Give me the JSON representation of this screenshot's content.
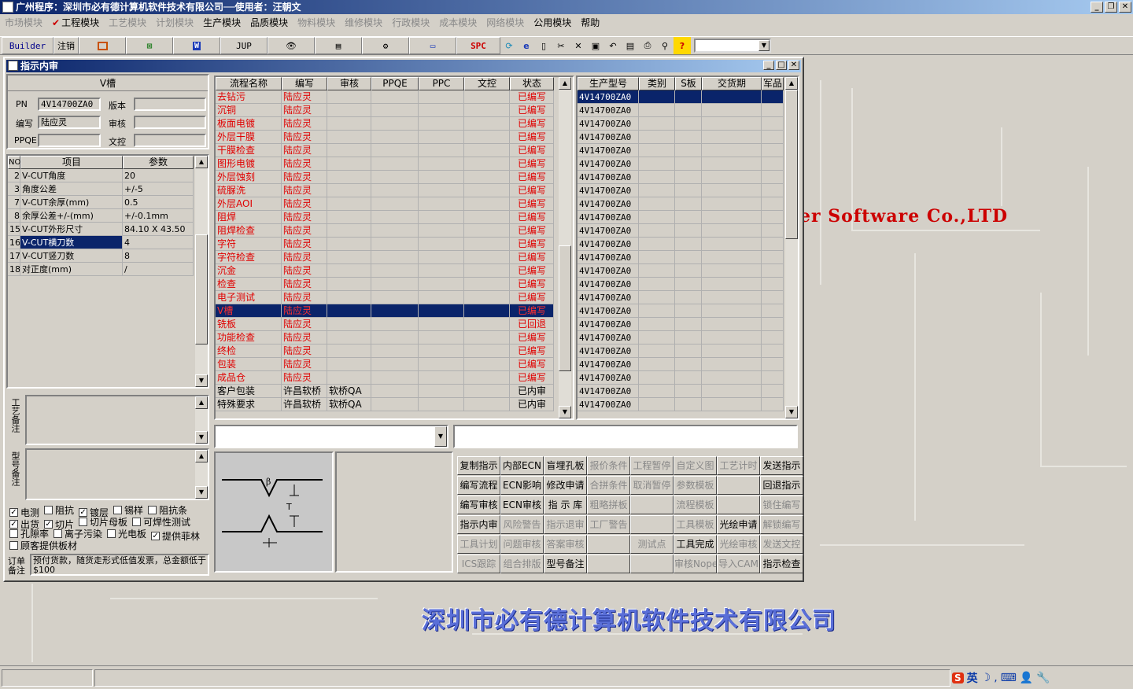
{
  "app_title": "广州程序：深圳市必有德计算机软件技术有限公司──使用者：汪朝文",
  "menus": [
    {
      "label": "市场模块",
      "on": false
    },
    {
      "label": "工程模块",
      "on": true,
      "checked": true
    },
    {
      "label": "工艺模块",
      "on": false
    },
    {
      "label": "计划模块",
      "on": false
    },
    {
      "label": "生产模块",
      "on": true
    },
    {
      "label": "品质模块",
      "on": true
    },
    {
      "label": "物料模块",
      "on": false
    },
    {
      "label": "维修模块",
      "on": false
    },
    {
      "label": "行政模块",
      "on": false
    },
    {
      "label": "成本模块",
      "on": false
    },
    {
      "label": "网络模块",
      "on": false
    },
    {
      "label": "公用模块",
      "on": true
    },
    {
      "label": "帮助",
      "on": true
    }
  ],
  "toolbar": {
    "builder": "Builder",
    "logout": "注销",
    "jup": "JUP",
    "spc": "SPC"
  },
  "bg_text": "er Software Co.,LTD",
  "company": "深圳市必有德计算机软件技术有限公司",
  "window": {
    "title": "指示内审"
  },
  "header": {
    "process": "V槽",
    "pn_label": "PN",
    "pn": "4V14700ZA0",
    "version_label": "版本",
    "version": "",
    "writer_label": "编写",
    "writer": "陆应灵",
    "review_label": "审核",
    "review": "",
    "ppqe_label": "PPQE",
    "ppqe": "",
    "doc_label": "文控",
    "doc": ""
  },
  "param_table": {
    "cols": [
      "NO",
      "项目",
      "参数"
    ],
    "rows": [
      [
        "2",
        "V-CUT角度",
        "20"
      ],
      [
        "3",
        "角度公差",
        "+/-5"
      ],
      [
        "7",
        "V-CUT余厚(mm)",
        "0.5"
      ],
      [
        "8",
        "余厚公差+/-(mm)",
        "+/-0.1mm"
      ],
      [
        "15",
        "V-CUT外形尺寸",
        "84.10 X 43.50"
      ],
      [
        "16",
        "V-CUT横刀数",
        "4"
      ],
      [
        "17",
        "V-CUT竖刀数",
        "8"
      ],
      [
        "18",
        "对正度(mm)",
        "/"
      ]
    ]
  },
  "memo_labels": {
    "craft": "工艺备注",
    "model": "型号备注",
    "order": "订单备注"
  },
  "checkboxes": [
    [
      {
        "label": "电测",
        "checked": true
      },
      {
        "label": "阻抗",
        "checked": false
      },
      {
        "label": "镀层",
        "checked": true
      },
      {
        "label": "锡样",
        "checked": false
      },
      {
        "label": "阻抗条",
        "checked": false
      }
    ],
    [
      {
        "label": "出货",
        "checked": true
      },
      {
        "label": "切片",
        "checked": true
      },
      {
        "label": "切片母板",
        "checked": false
      },
      {
        "label": "可焊性测试",
        "checked": false
      }
    ],
    [
      {
        "label": "孔隙率",
        "checked": false
      },
      {
        "label": "离子污染",
        "checked": false
      },
      {
        "label": "光电板",
        "checked": false
      },
      {
        "label": "提供菲林",
        "checked": true
      }
    ],
    [
      {
        "label": "顾客提供板材",
        "checked": false
      }
    ]
  ],
  "order_note": "预付货款，随货走形式低值发票，总金额低于$100",
  "flow_table": {
    "cols": [
      "流程名称",
      "编写",
      "审核",
      "PPQE",
      "PPC",
      "文控",
      "状态"
    ],
    "rows": [
      {
        "name": "去钻污",
        "writer": "陆应灵",
        "review": "",
        "ppqe": "",
        "ppc": "",
        "doc": "",
        "status": "已编写",
        "red": true
      },
      {
        "name": "沉铜",
        "writer": "陆应灵",
        "review": "",
        "ppqe": "",
        "ppc": "",
        "doc": "",
        "status": "已编写",
        "red": true
      },
      {
        "name": "板面电镀",
        "writer": "陆应灵",
        "review": "",
        "ppqe": "",
        "ppc": "",
        "doc": "",
        "status": "已编写",
        "red": true
      },
      {
        "name": "外层干膜",
        "writer": "陆应灵",
        "review": "",
        "ppqe": "",
        "ppc": "",
        "doc": "",
        "status": "已编写",
        "red": true
      },
      {
        "name": "干膜检查",
        "writer": "陆应灵",
        "review": "",
        "ppqe": "",
        "ppc": "",
        "doc": "",
        "status": "已编写",
        "red": true
      },
      {
        "name": "图形电镀",
        "writer": "陆应灵",
        "review": "",
        "ppqe": "",
        "ppc": "",
        "doc": "",
        "status": "已编写",
        "red": true
      },
      {
        "name": "外层蚀刻",
        "writer": "陆应灵",
        "review": "",
        "ppqe": "",
        "ppc": "",
        "doc": "",
        "status": "已编写",
        "red": true
      },
      {
        "name": "硫脲洗",
        "writer": "陆应灵",
        "review": "",
        "ppqe": "",
        "ppc": "",
        "doc": "",
        "status": "已编写",
        "red": true
      },
      {
        "name": "外层AOI",
        "writer": "陆应灵",
        "review": "",
        "ppqe": "",
        "ppc": "",
        "doc": "",
        "status": "已编写",
        "red": true
      },
      {
        "name": "阻焊",
        "writer": "陆应灵",
        "review": "",
        "ppqe": "",
        "ppc": "",
        "doc": "",
        "status": "已编写",
        "red": true
      },
      {
        "name": "阻焊检查",
        "writer": "陆应灵",
        "review": "",
        "ppqe": "",
        "ppc": "",
        "doc": "",
        "status": "已编写",
        "red": true
      },
      {
        "name": "字符",
        "writer": "陆应灵",
        "review": "",
        "ppqe": "",
        "ppc": "",
        "doc": "",
        "status": "已编写",
        "red": true
      },
      {
        "name": "字符检查",
        "writer": "陆应灵",
        "review": "",
        "ppqe": "",
        "ppc": "",
        "doc": "",
        "status": "已编写",
        "red": true
      },
      {
        "name": "沉金",
        "writer": "陆应灵",
        "review": "",
        "ppqe": "",
        "ppc": "",
        "doc": "",
        "status": "已编写",
        "red": true
      },
      {
        "name": "检查",
        "writer": "陆应灵",
        "review": "",
        "ppqe": "",
        "ppc": "",
        "doc": "",
        "status": "已编写",
        "red": true
      },
      {
        "name": "电子测试",
        "writer": "陆应灵",
        "review": "",
        "ppqe": "",
        "ppc": "",
        "doc": "",
        "status": "已编写",
        "red": true
      },
      {
        "name": "V槽",
        "writer": "陆应灵",
        "review": "",
        "ppqe": "",
        "ppc": "",
        "doc": "",
        "status": "已编写",
        "red": true,
        "selected": true
      },
      {
        "name": "铣板",
        "writer": "陆应灵",
        "review": "",
        "ppqe": "",
        "ppc": "",
        "doc": "",
        "status": "已回退",
        "red": true
      },
      {
        "name": "功能检查",
        "writer": "陆应灵",
        "review": "",
        "ppqe": "",
        "ppc": "",
        "doc": "",
        "status": "已编写",
        "red": true
      },
      {
        "name": "终检",
        "writer": "陆应灵",
        "review": "",
        "ppqe": "",
        "ppc": "",
        "doc": "",
        "status": "已编写",
        "red": true
      },
      {
        "name": "包装",
        "writer": "陆应灵",
        "review": "",
        "ppqe": "",
        "ppc": "",
        "doc": "",
        "status": "已编写",
        "red": true
      },
      {
        "name": "成品仓",
        "writer": "陆应灵",
        "review": "",
        "ppqe": "",
        "ppc": "",
        "doc": "",
        "status": "已编写",
        "red": true
      },
      {
        "name": "客户包装",
        "writer": "许昌软桥",
        "review": "软桥QA",
        "ppqe": "",
        "ppc": "",
        "doc": "",
        "status": "已内审",
        "red": false
      },
      {
        "name": "特殊要求",
        "writer": "许昌软桥",
        "review": "软桥QA",
        "ppqe": "",
        "ppc": "",
        "doc": "",
        "status": "已内审",
        "red": false
      }
    ]
  },
  "model_table": {
    "cols": [
      "生产型号",
      "类别",
      "S板",
      "交货期",
      "军品"
    ],
    "model": "4V14700ZA0",
    "count": 24
  },
  "diagram": {
    "beta": "β",
    "t": "T"
  },
  "action_buttons": [
    [
      {
        "l": "复制指示",
        "d": false
      },
      {
        "l": "内部ECN",
        "d": false
      },
      {
        "l": "盲埋孔板",
        "d": false
      },
      {
        "l": "报价条件",
        "d": true
      },
      {
        "l": "工程暂停",
        "d": true
      },
      {
        "l": "自定义图",
        "d": true
      },
      {
        "l": "工艺计时",
        "d": true
      },
      {
        "l": "发送指示",
        "d": false
      }
    ],
    [
      {
        "l": "编写流程",
        "d": false
      },
      {
        "l": "ECN影响",
        "d": false
      },
      {
        "l": "修改申请",
        "d": false
      },
      {
        "l": "合拼条件",
        "d": true
      },
      {
        "l": "取消暂停",
        "d": true
      },
      {
        "l": "参数模板",
        "d": true
      },
      {
        "l": "",
        "d": true
      },
      {
        "l": "回退指示",
        "d": false
      }
    ],
    [
      {
        "l": "编写审核",
        "d": false
      },
      {
        "l": "ECN审核",
        "d": false
      },
      {
        "l": "指 示 库",
        "d": false
      },
      {
        "l": "粗略拼板",
        "d": true
      },
      {
        "l": "",
        "d": true
      },
      {
        "l": "流程模板",
        "d": true
      },
      {
        "l": "",
        "d": true
      },
      {
        "l": "锁住编写",
        "d": true
      }
    ],
    [
      {
        "l": "指示内审",
        "d": false
      },
      {
        "l": "风险警告",
        "d": true
      },
      {
        "l": "指示退审",
        "d": true
      },
      {
        "l": "工厂警告",
        "d": true
      },
      {
        "l": "",
        "d": true
      },
      {
        "l": "工具模板",
        "d": true
      },
      {
        "l": "光绘申请",
        "d": false
      },
      {
        "l": "解锁编写",
        "d": true
      }
    ],
    [
      {
        "l": "工具计划",
        "d": true
      },
      {
        "l": "问题审核",
        "d": true
      },
      {
        "l": "答案审核",
        "d": true
      },
      {
        "l": "",
        "d": true
      },
      {
        "l": "测试点",
        "d": true
      },
      {
        "l": "工具完成",
        "d": false
      },
      {
        "l": "光绘审核",
        "d": true
      },
      {
        "l": "发送文控",
        "d": true
      }
    ],
    [
      {
        "l": "ICS跟踪",
        "d": true
      },
      {
        "l": "组合排版",
        "d": true
      },
      {
        "l": "型号备注",
        "d": false
      },
      {
        "l": "",
        "d": true
      },
      {
        "l": "",
        "d": true
      },
      {
        "l": "审核Nope",
        "d": true
      },
      {
        "l": "导入CAM",
        "d": true
      },
      {
        "l": "指示检查",
        "d": false
      }
    ]
  ],
  "tray": {
    "ime": "英"
  }
}
